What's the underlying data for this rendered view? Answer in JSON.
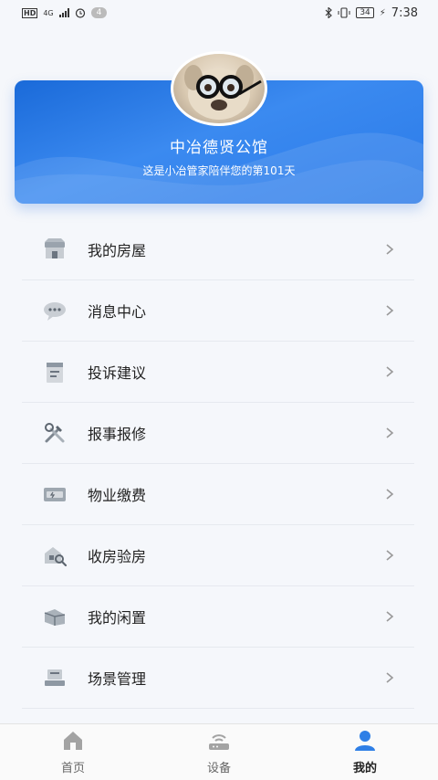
{
  "statusbar": {
    "hd": "HD",
    "network": "4G",
    "badge": "4",
    "battery": "34",
    "time": "7:38"
  },
  "header": {
    "community_name": "中冶德贤公馆",
    "subtitle": "这是小冶管家陪伴您的第101天"
  },
  "menu": {
    "items": [
      {
        "label": "我的房屋",
        "icon": "house-icon"
      },
      {
        "label": "消息中心",
        "icon": "message-icon"
      },
      {
        "label": "投诉建议",
        "icon": "complaint-icon"
      },
      {
        "label": "报事报修",
        "icon": "repair-tools-icon"
      },
      {
        "label": "物业缴费",
        "icon": "payment-card-icon"
      },
      {
        "label": "收房验房",
        "icon": "house-inspection-icon"
      },
      {
        "label": "我的闲置",
        "icon": "idle-items-icon"
      },
      {
        "label": "场景管理",
        "icon": "scene-icon"
      }
    ]
  },
  "tabs": [
    {
      "label": "首页",
      "icon": "home-icon"
    },
    {
      "label": "设备",
      "icon": "device-router-icon"
    },
    {
      "label": "我的",
      "icon": "user-icon"
    }
  ],
  "colors": {
    "accent": "#1f6fe0",
    "tab_active": "#2f7fe6",
    "tab_inactive": "#9a9a9a"
  }
}
